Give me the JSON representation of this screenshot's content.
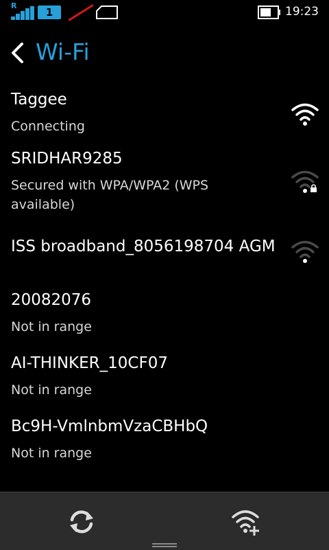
{
  "status_bar": {
    "roaming_label": "R",
    "sim_label": "1",
    "time": "19:23",
    "battery_level": 0.65,
    "icons": [
      "signal-icon",
      "sim-icon",
      "no-data-icon",
      "sd-card-icon",
      "battery-icon"
    ]
  },
  "header": {
    "title": "Wi-Fi",
    "back_icon": "chevron-left-icon"
  },
  "networks": [
    {
      "name": "Taggee",
      "status": "Connecting",
      "signal_icon": "wifi-strong-icon",
      "secured": false
    },
    {
      "name": "SRIDHAR9285",
      "status": "Secured with WPA/WPA2 (WPS available)",
      "signal_icon": "wifi-weak-lock-icon",
      "secured": true
    },
    {
      "name": "ISS broadband_8056198704 AGM",
      "status": "",
      "signal_icon": "wifi-weak-icon",
      "secured": false
    },
    {
      "name": "20082076",
      "status": "Not in range"
    },
    {
      "name": "AI-THINKER_10CF07",
      "status": "Not in range"
    },
    {
      "name": "Bc9H-VmlnbmVzaCBHbQ",
      "status": "Not in range"
    }
  ],
  "toolbar": {
    "refresh_icon": "refresh-icon",
    "add_network_icon": "wifi-add-icon"
  },
  "colors": {
    "accent": "#27a0d8",
    "background": "#000000",
    "toolbar": "#2c2c2c",
    "no_data_slash": "#d0191b"
  }
}
